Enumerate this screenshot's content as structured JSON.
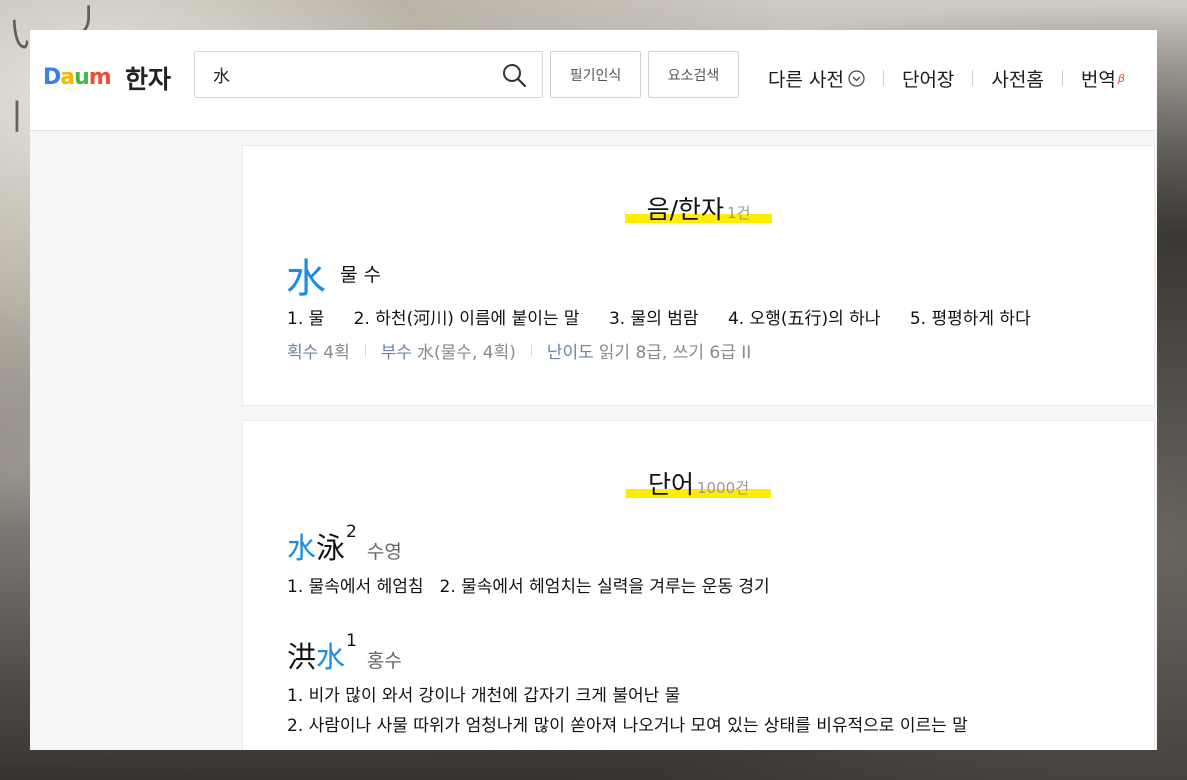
{
  "header": {
    "logo_letters": [
      "D",
      "a",
      "u",
      "m"
    ],
    "title": "한자",
    "search": {
      "value": "水"
    },
    "buttons": {
      "handwriting": "필기인식",
      "element_search": "요소검색"
    },
    "nav": [
      {
        "label": "다른 사전"
      },
      {
        "label": "단어장"
      },
      {
        "label": "사전홈"
      },
      {
        "label": "번역",
        "badge": "β"
      }
    ]
  },
  "hanja_section": {
    "title": "음/한자",
    "count": "1건",
    "entry": {
      "char": "水",
      "reading": "물 수",
      "meanings": [
        "1. 물",
        "2. 하천(河川) 이름에 붙이는 말",
        "3. 물의 범람",
        "4. 오행(五行)의 하나",
        "5. 평평하게 하다"
      ],
      "meta": {
        "strokes_label": "획수",
        "strokes_value": "4획",
        "radical_label": "부수",
        "radical_value": "水(물수, 4획)",
        "level_label": "난이도",
        "level_value": "읽기 8급, 쓰기 6급 II"
      }
    }
  },
  "word_section": {
    "title": "단어",
    "count": "1000건",
    "words": [
      {
        "char1": "水",
        "char2": "泳",
        "sup": "2",
        "reading": "수영",
        "defs": [
          "1. 물속에서 헤엄침",
          "2. 물속에서 헤엄치는 실력을 겨루는 운동 경기"
        ]
      },
      {
        "char1": "洪",
        "char2": "水",
        "sup": "1",
        "reading": "홍수",
        "defs": [
          "1. 비가 많이 와서 강이나 개천에 갑자기 크게 불어난 물",
          "2. 사람이나 사물 따위가 엄청나게 많이 쏟아져 나오거나 모여 있는 상태를 비유적으로 이르는 말"
        ]
      }
    ]
  },
  "colors": {
    "brand_blue": "#1c8de0",
    "highlight_yellow": "#ffed00",
    "meta_label": "#6f83a8",
    "logo": [
      "#3b7de9",
      "#f5b800",
      "#45b649",
      "#ee4c35"
    ]
  },
  "icons": [
    "search-icon",
    "chevron-down-icon"
  ]
}
